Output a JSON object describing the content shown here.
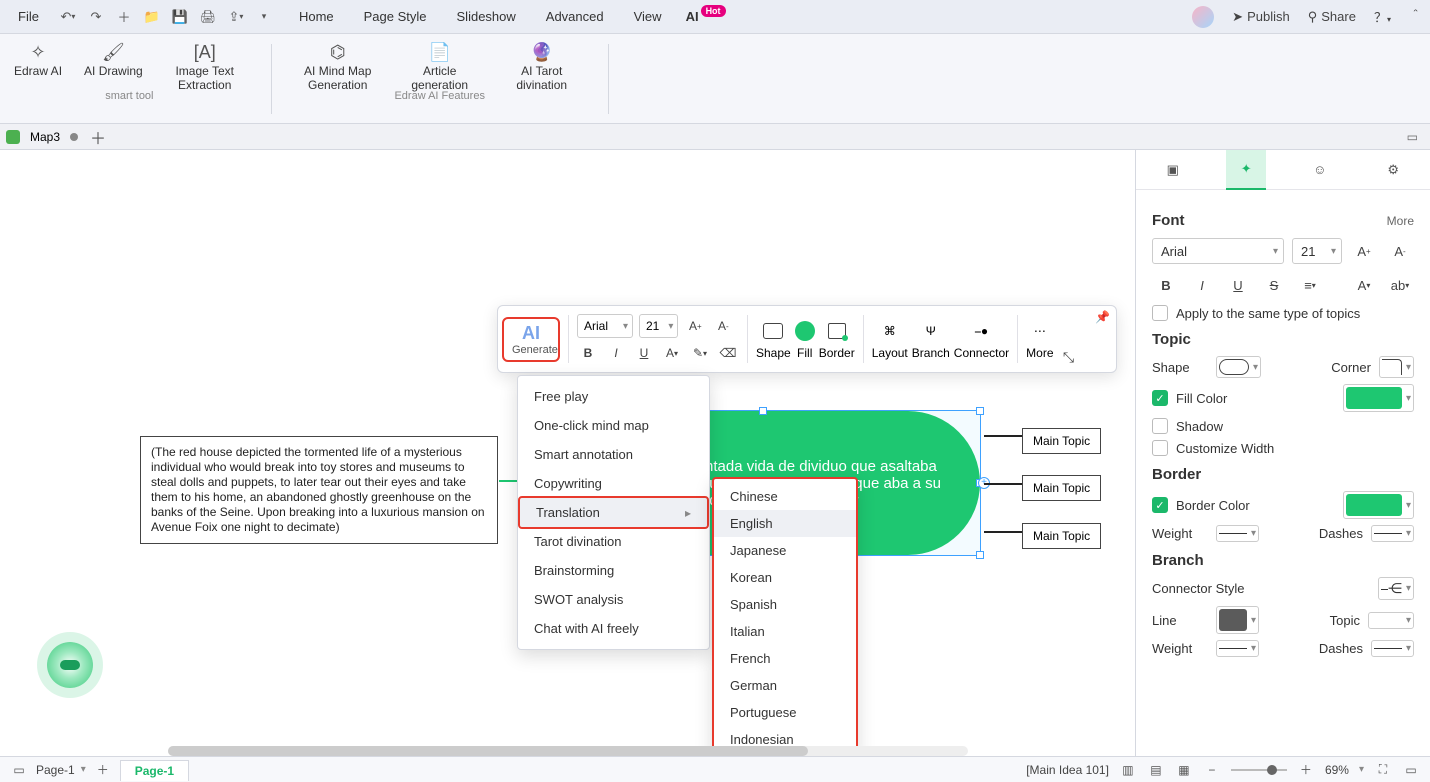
{
  "menubar": {
    "file": "File",
    "tabs": [
      "Home",
      "Page Style",
      "Slideshow",
      "Advanced",
      "View"
    ],
    "ai_label": "AI",
    "hot": "Hot",
    "publish": "Publish",
    "share": "Share"
  },
  "ribbon": {
    "buttons": [
      {
        "label": "Edraw AI"
      },
      {
        "label": "AI Drawing"
      },
      {
        "label": "Image Text Extraction"
      },
      {
        "label": "AI Mind Map Generation"
      },
      {
        "label": "Article generation"
      },
      {
        "label": "AI Tarot divination"
      }
    ],
    "group1_label": "smart tool",
    "group2_label": "Edraw AI Features"
  },
  "doctab": {
    "name": "Map3"
  },
  "float_tb": {
    "ai_text": "AI",
    "generate": "Generate",
    "font": "Arial",
    "size": "21",
    "shape": "Shape",
    "fill": "Fill",
    "border": "Border",
    "layout": "Layout",
    "branch": "Branch",
    "connector": "Connector",
    "more": "More"
  },
  "dropdown": {
    "items": [
      "Free play",
      "One-click mind map",
      "Smart annotation",
      "Copywriting",
      "Translation",
      "Tarot divination",
      "Brainstorming",
      "SWOT analysis",
      "Chat with AI freely"
    ],
    "highlight_index": 4
  },
  "submenu": {
    "items": [
      "Chinese",
      "English",
      "Japanese",
      "Korean",
      "Spanish",
      "Italian",
      "French",
      "German",
      "Portuguese",
      "Indonesian"
    ],
    "highlight_index": 1
  },
  "note_text": "(The red house depicted the tormented life of a mysterious individual who would break into toy stores and museums to steal dolls and puppets, to later tear out their eyes and take them to his home, an abandoned ghostly greenhouse on the banks of the Seine. Upon breaking into a luxurious mansion on Avenue Foix one night to decimate)",
  "oval_text": "elataba la atormentada vida de dividuo que asaltaba jugueterias obar munecos y titeres,a los que aba a su ndonado e en una a diezmar",
  "main_topic": "Main Topic",
  "right_panel": {
    "font_title": "Font",
    "more": "More",
    "font_family": "Arial",
    "font_size": "21",
    "apply_same": "Apply to the same type of topics",
    "topic_title": "Topic",
    "shape_label": "Shape",
    "corner_label": "Corner",
    "fill_color": "Fill Color",
    "shadow": "Shadow",
    "customize_width": "Customize Width",
    "border_title": "Border",
    "border_color": "Border Color",
    "weight": "Weight",
    "dashes": "Dashes",
    "branch_title": "Branch",
    "connector_style": "Connector Style",
    "line": "Line",
    "topic_sel": "Topic"
  },
  "statusbar": {
    "page_main": "Page-1",
    "page_tab": "Page-1",
    "main_idea": "[Main Idea 101]",
    "zoom": "69%"
  }
}
